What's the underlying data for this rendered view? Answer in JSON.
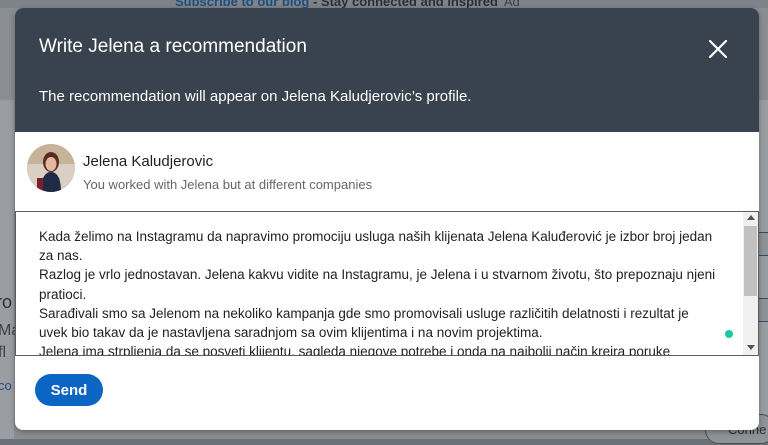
{
  "background": {
    "promo_link": "Subscribe to our blog",
    "promo_rest": " - Stay connected and inspired",
    "promo_ad": "Ad",
    "left_text_1": "ro",
    "left_text_2": "Ma",
    "left_text_3": "fl",
    "left_text_4": "co",
    "right_bottom_button": "Conne"
  },
  "modal": {
    "title": "Write Jelena a recommendation",
    "subtitle": "The recommendation will appear on Jelena Kaludjerovic’s profile.",
    "close_icon": "close-icon",
    "profile": {
      "name": "Jelena Kaludjerovic",
      "relationship": "You worked with Jelena but at different companies"
    },
    "recommendation_text": "Kada želimo na Instagramu da napravimo promociju usluga naših klijenata Jelena Kaluđerović je izbor broj jedan za nas.\nRazlog je vrlo jednostavan. Jelena kakvu vidite na Instagramu, je Jelena i u stvarnom životu, što prepoznaju njeni pratioci.\nSarađivali smo sa Jelenom na nekoliko kampanja gde smo promovisali usluge različitih delatnosti i rezultat je uvek bio takav da je nastavljena saradnjom sa ovim klijentima i na novim projektima.\nJelena ima strpljenja da se posveti klijentu, sagleda njegove potrebe i onda na najbolji način kreira poruke",
    "send_label": "Send"
  },
  "colors": {
    "header_bg": "#38434f",
    "primary": "#0a66c2",
    "status_dot": "#1ec7a3"
  }
}
